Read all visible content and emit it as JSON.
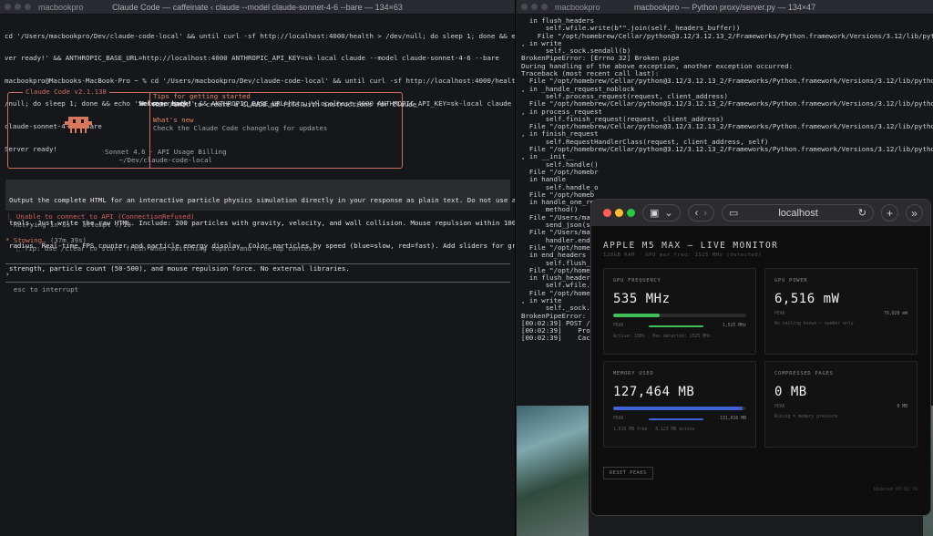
{
  "term1": {
    "host": "macbookpro",
    "title": "Claude Code — caffeinate ‹ claude --model claude-sonnet-4-6 --bare — 134×63",
    "cmd_lines": [
      "cd '/Users/macbookpro/Dev/claude-code-local' && until curl -sf http://localhost:4000/health > /dev/null; do sleep 1; done && echo 'Ser",
      "ver ready!' && ANTHROPIC_BASE_URL=http://localhost:4000 ANTHROPIC_API_KEY=sk-local claude --model claude-sonnet-4-6 --bare",
      "macbookpro@Macbooks-MacBook-Pro ~ % cd '/Users/macbookpro/Dev/claude-code-local' && until curl -sf http://localhost:4000/health > dev",
      "/null; do sleep 1; done && echo 'Server ready!' && ANTHROPIC_BASE_URL=http://localhost:4000 ANTHROPIC_API_KEY=sk-local claude --model",
      "claude-sonnet-4-6 --bare",
      "Server ready!"
    ],
    "welcome": {
      "tag": "Claude Code v2.1.138",
      "back": "Welcome back!",
      "model": "Sonnet 4.6 · API Usage Billing",
      "dir": "~/Dev/claude-code-local",
      "tips_title": "Tips for getting started",
      "tips_text": "Run /init to create a CLAUDE.md file with instructions for Claude",
      "new_title": "What's new",
      "new_text": "Check the Claude Code changelog for updates"
    },
    "prompt_lines": [
      "Output the complete HTML for an interactive particle physics simulation directly in your response as plain text. Do not use any",
      "tools. Just write the raw HTML. Include: 200 particles with gravity, velocity, and wall collision. Mouse repulsion within 100px",
      "radius. Real-time FPS counter and particle energy display. Color particles by speed (blue=slow, red=fast). Add sliders for gravity",
      "strength, particle count (50-500), and mouse repulsion force. No external libraries."
    ],
    "error": "⎿ Unable to connect to API (ConnectionRefused)",
    "retry": "  Retrying in 8s · attempt 7/10",
    "stowing": "* Stowing… ",
    "stowing_time": "(37m 39s)",
    "tip": "  ⎿ Tip: Use /clear to start fresh when switching topics and free up context",
    "input_caret": "›",
    "footer": "  esc to interrupt"
  },
  "term2": {
    "host": "macbookpro",
    "title": "macbookpro — Python proxy/server.py — 134×47",
    "lines": [
      "  in flush_headers",
      "      self.wfile.write(b\"\".join(self._headers_buffer))",
      "    File \"/opt/homebrew/Cellar/python@3.12/3.12.13_2/Frameworks/Python.framework/Versions/3.12/lib/python3.12/",
      ", in write",
      "      self._sock.sendall(b)",
      "BrokenPipeError: [Errno 32] Broken pipe",
      "",
      "During handling of the above exception, another exception occurred:",
      "",
      "Traceback (most recent call last):",
      "  File \"/opt/homebrew/Cellar/python@3.12/3.12.13_2/Frameworks/Python.framework/Versions/3.12/lib/python3.12/",
      ", in _handle_request_noblock",
      "      self.process_request(request, client_address)",
      "  File \"/opt/homebrew/Cellar/python@3.12/3.12.13_2/Frameworks/Python.framework/Versions/3.12/lib/python3.12/",
      ", in process_request",
      "      self.finish_request(request, client_address)",
      "  File \"/opt/homebrew/Cellar/python@3.12/3.12.13_2/Frameworks/Python.framework/Versions/3.12/lib/python3.12/",
      ", in finish_request",
      "      self.RequestHandlerClass(request, client_address, self)",
      "  File \"/opt/homebrew/Cellar/python@3.12/3.12.13_2/Frameworks/Python.framework/Versions/3.12/lib/python3.12/",
      ", in __init__",
      "      self.handle()",
      "  File \"/opt/homebr",
      "  in handle",
      "      self.handle_o",
      "  File \"/opt/homeb",
      "  in handle_one_re",
      "      method()",
      "  File \"/Users/ma",
      "      send_json(sel",
      "  File \"/Users/ma",
      "      handler.end_h",
      "  File \"/opt/homeb",
      "  in end_headers",
      "      self.flush_he",
      "  File \"/opt/homeb",
      "  in flush_headers",
      "      self.wfile.wr",
      "  File \"/opt/homeb",
      ", in write",
      "      self._sock.se",
      "BrokenPipeError:",
      "",
      "[00:02:39] POST /",
      "[00:02:39]    Prom",
      "[00:02:39]    Cach"
    ]
  },
  "browser": {
    "url": "localhost",
    "title": "APPLE M5 MAX — LIVE MONITOR",
    "subtitle": "128GB RAM · GPU max freq: 1525 MHz (detected)",
    "cards": [
      {
        "label": "GPU FREQUENCY",
        "value": "535 MHz",
        "peak_label": "PEAK",
        "peak": "1,525 MHz",
        "note": "Active: 100% · Max detected: 1525 MHz",
        "fill": 0.35,
        "peak_fill": 1.0,
        "color": "#3fbf5a"
      },
      {
        "label": "GPU POWER",
        "value": "6,516 mW",
        "peak_label": "PEAK",
        "peak": "70,028 mW",
        "note": "No ceiling known — number only",
        "color": "#888888"
      },
      {
        "label": "MEMORY USED",
        "value": "127,464 MB",
        "peak_label": "PEAK",
        "peak": "131,016 MB",
        "note": "1,616 MB free · 8,123 MB active",
        "fill": 0.97,
        "peak_fill": 1.0,
        "color": "#3f63d6"
      },
      {
        "label": "COMPRESSED PAGES",
        "value": "0 MB",
        "peak_label": "PEAK",
        "peak": "0 MB",
        "note": "Rising = memory pressure",
        "color": "#888888"
      }
    ],
    "reset_label": "RESET PEAKS",
    "updated": "Updated 00:02:39"
  },
  "colors": {
    "red": "#ff5f57",
    "yellow": "#febc2e",
    "green": "#28c840"
  }
}
